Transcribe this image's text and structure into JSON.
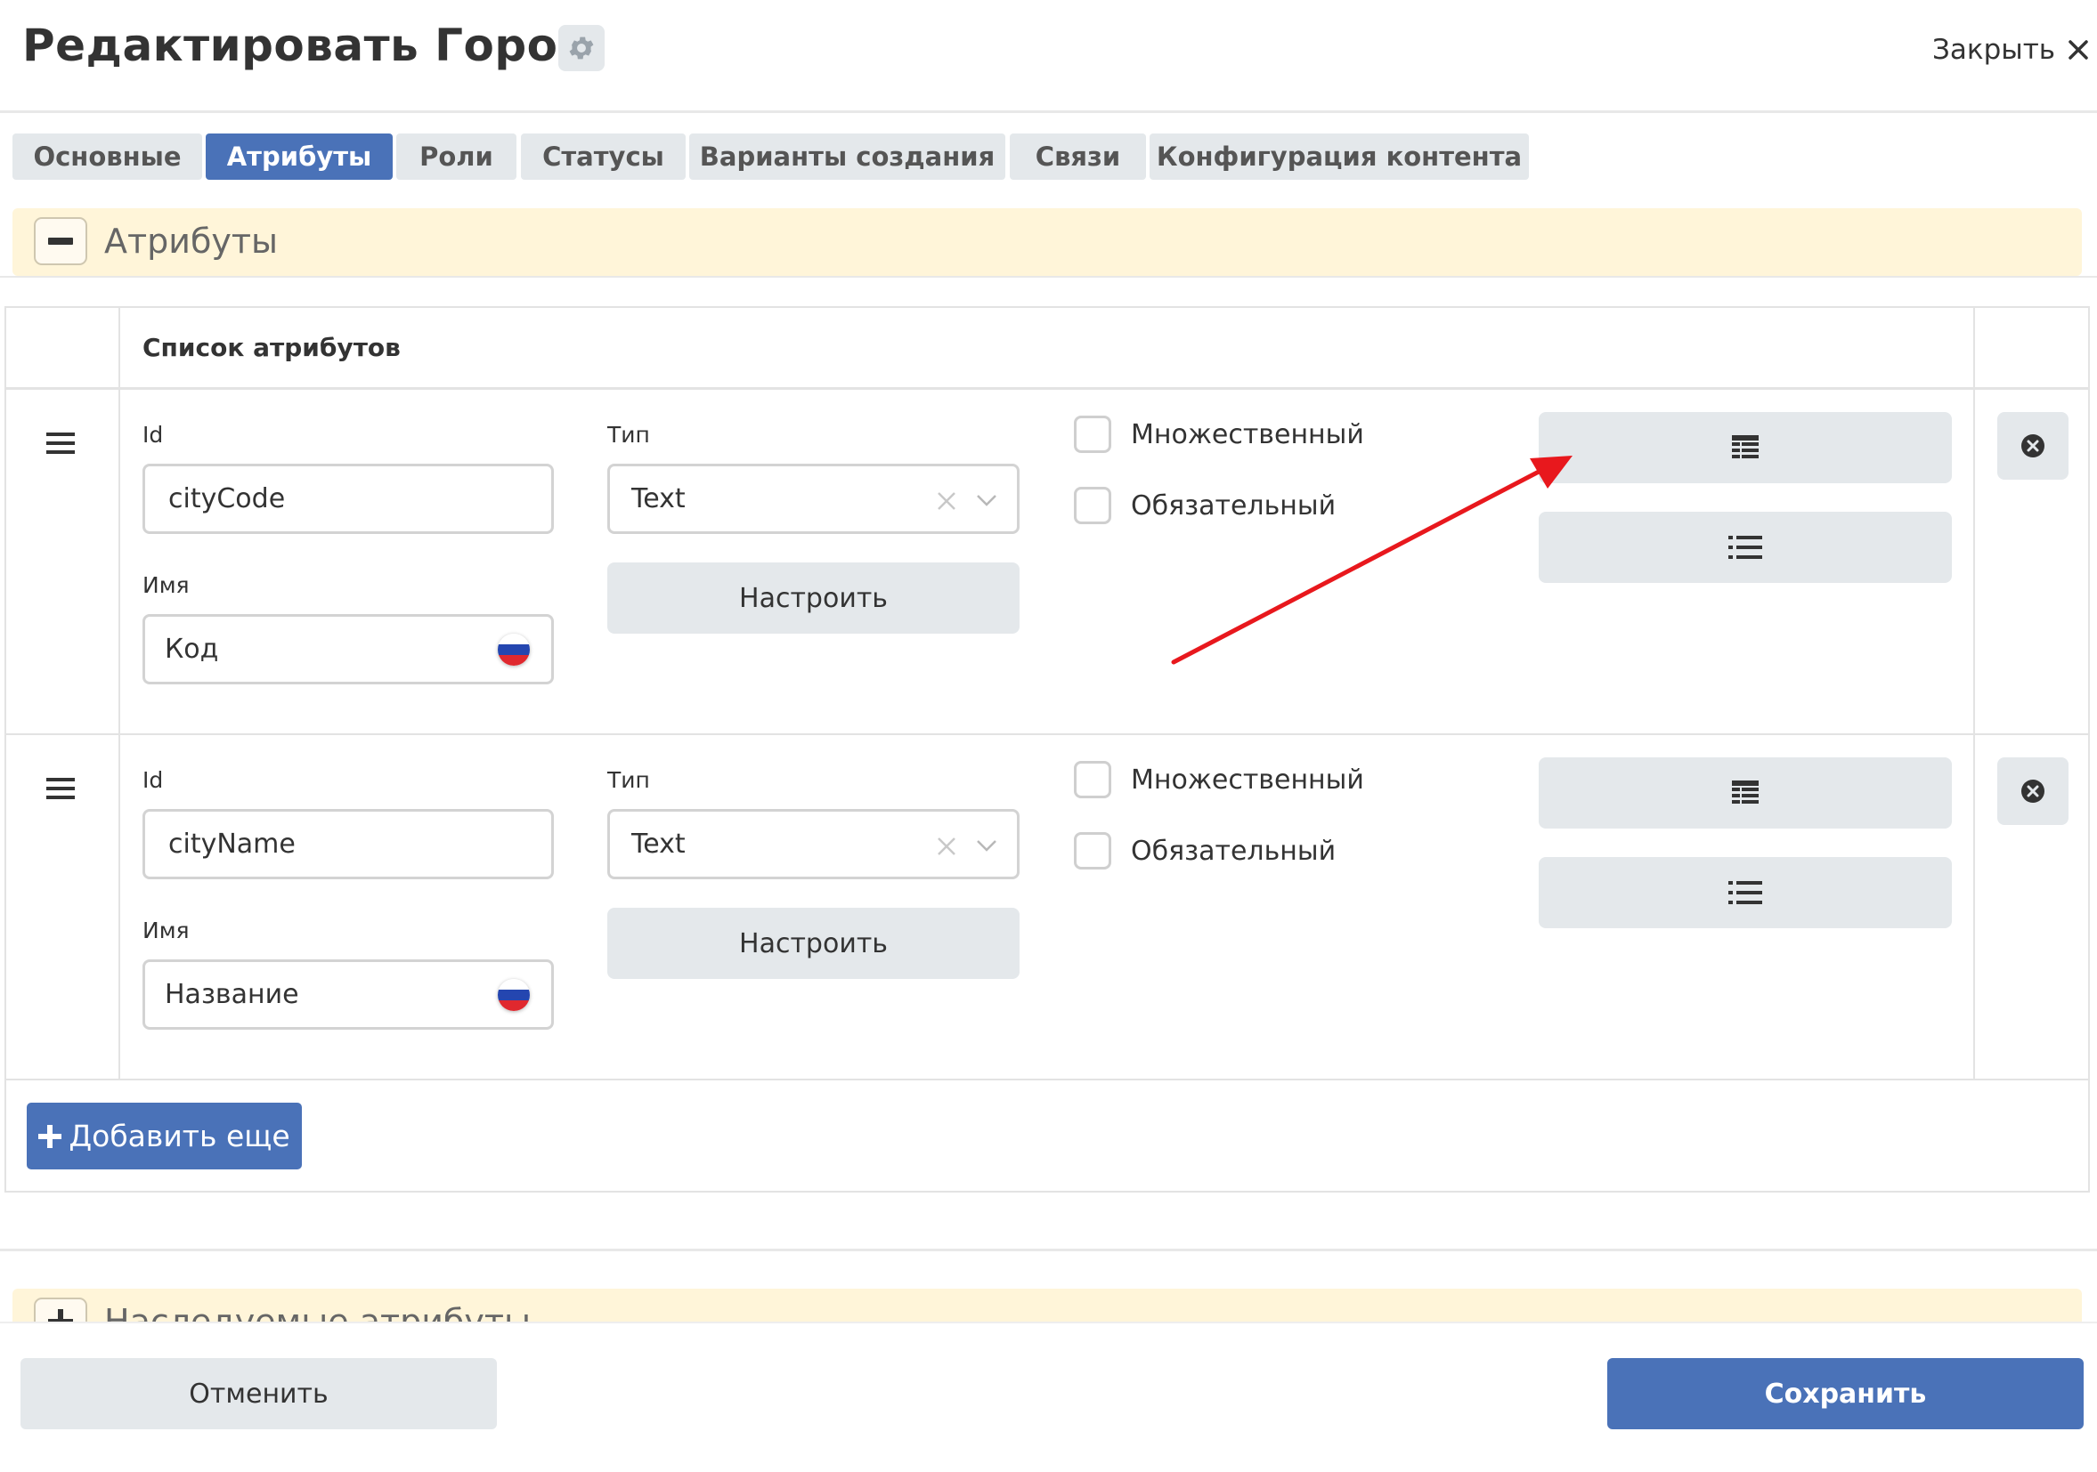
{
  "header": {
    "title": "Редактировать Город",
    "close_label": "Закрыть"
  },
  "tabs": [
    {
      "label": "Основные",
      "active": false
    },
    {
      "label": "Атрибуты",
      "active": true
    },
    {
      "label": "Роли",
      "active": false
    },
    {
      "label": "Статусы",
      "active": false
    },
    {
      "label": "Варианты создания",
      "active": false
    },
    {
      "label": "Связи",
      "active": false
    },
    {
      "label": "Конфигурация контента",
      "active": false
    }
  ],
  "section_attributes": {
    "title": "Атрибуты",
    "expanded": true
  },
  "attr_table": {
    "header": "Список атрибутов",
    "rows": [
      {
        "id_label": "Id",
        "id_value": "cityCode",
        "type_label": "Тип",
        "type_value": "Text",
        "name_label": "Имя",
        "name_value": "Код",
        "configure_label": "Настроить",
        "multiple_label": "Множественный",
        "multiple_checked": false,
        "required_label": "Обязательный",
        "required_checked": false
      },
      {
        "id_label": "Id",
        "id_value": "cityName",
        "type_label": "Тип",
        "type_value": "Text",
        "name_label": "Имя",
        "name_value": "Название",
        "configure_label": "Настроить",
        "multiple_label": "Множественный",
        "multiple_checked": false,
        "required_label": "Обязательный",
        "required_checked": false
      }
    ],
    "add_label": "Добавить еще"
  },
  "section_inherited": {
    "title": "Наследуемые атрибуты",
    "expanded": false
  },
  "footer": {
    "cancel_label": "Отменить",
    "save_label": "Сохранить"
  },
  "colors": {
    "primary": "#4a72b8",
    "button_grey": "#e4e8eb",
    "accordion_bg": "#fff5d9",
    "annotation_arrow": "#e8181d"
  },
  "icons": {
    "settings": "gear-icon",
    "close": "close-icon",
    "drag": "drag-handle-icon",
    "table": "table-icon",
    "list": "list-icon",
    "delete": "remove-circle-icon",
    "flag": "russia-flag-icon",
    "clear": "clear-x-icon",
    "chevron": "chevron-down-icon"
  }
}
